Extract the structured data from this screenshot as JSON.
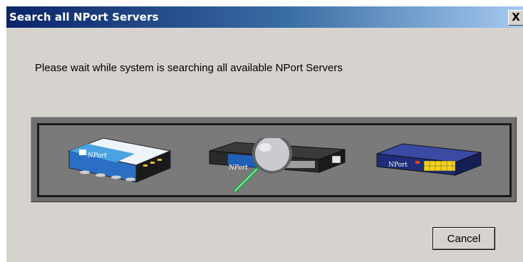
{
  "dialog": {
    "title": "Search all NPort Servers",
    "close_label": "X",
    "message": "Please wait while system is searching all available NPort Servers",
    "cancel_label": "Cancel"
  },
  "devices": [
    {
      "name": "nport-device-1",
      "label": "NPort"
    },
    {
      "name": "nport-device-2",
      "label": "NPort"
    },
    {
      "name": "nport-device-3",
      "label": "NPort"
    }
  ],
  "colors": {
    "title_start": "#0a246a",
    "title_end": "#a6caf0",
    "window_bg": "#d6d3ce",
    "panel_bg": "#7a7a7a"
  }
}
